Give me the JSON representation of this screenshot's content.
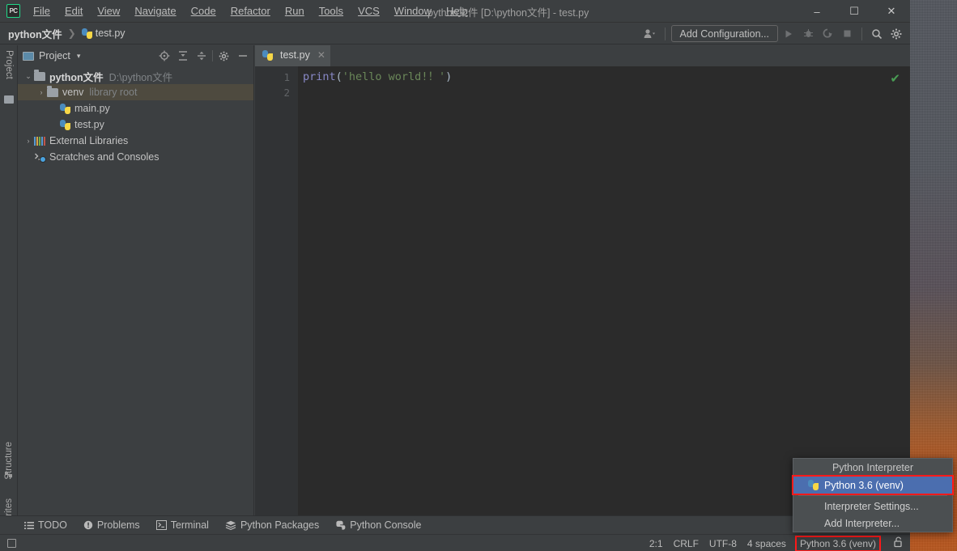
{
  "window": {
    "title": "python文件 [D:\\python文件] - test.py",
    "logo_label": "PC",
    "minimize": "–",
    "maximize": "☐",
    "close": "✕"
  },
  "menubar": {
    "items": [
      {
        "label": "File",
        "mnemonic": "F"
      },
      {
        "label": "Edit",
        "mnemonic": "E"
      },
      {
        "label": "View",
        "mnemonic": "V"
      },
      {
        "label": "Navigate",
        "mnemonic": "N"
      },
      {
        "label": "Code",
        "mnemonic": "C"
      },
      {
        "label": "Refactor",
        "mnemonic": "R"
      },
      {
        "label": "Run",
        "mnemonic": "u"
      },
      {
        "label": "Tools",
        "mnemonic": "T"
      },
      {
        "label": "VCS",
        "mnemonic": "S"
      },
      {
        "label": "Window",
        "mnemonic": "W"
      },
      {
        "label": "Help",
        "mnemonic": "H"
      }
    ]
  },
  "navbar": {
    "breadcrumbs": [
      {
        "label": "python文件"
      },
      {
        "label": "test.py"
      }
    ],
    "separator": "❯",
    "add_configuration": "Add Configuration...",
    "icons": {
      "user": "user-icon",
      "run": "▶",
      "debug": "debug-icon",
      "coverage": "coverage-icon",
      "stop": "■",
      "search": "search-icon",
      "settings": "gear-icon"
    }
  },
  "left_strip": {
    "project_label": "Project",
    "structure_label": "Structure",
    "favorites_label": "Favorites"
  },
  "project_panel": {
    "title": "Project",
    "dropdown": "▾",
    "actions": [
      "locate-icon",
      "expand-all-icon",
      "collapse-all-icon",
      "gear-icon",
      "hide-icon"
    ],
    "tree": [
      {
        "label": "python文件",
        "secondary": "D:\\python文件",
        "depth": 0,
        "arrow": "⌄",
        "icon": "folder-icon",
        "bold": true,
        "selected": false
      },
      {
        "label": "venv",
        "secondary": "library root",
        "depth": 1,
        "arrow": "›",
        "icon": "folder-icon",
        "bold": false,
        "selected": true
      },
      {
        "label": "main.py",
        "secondary": "",
        "depth": 2,
        "arrow": "",
        "icon": "python-file-icon",
        "bold": false,
        "selected": false
      },
      {
        "label": "test.py",
        "secondary": "",
        "depth": 2,
        "arrow": "",
        "icon": "python-file-icon",
        "bold": false,
        "selected": false
      },
      {
        "label": "External Libraries",
        "secondary": "",
        "depth": 0,
        "arrow": "›",
        "icon": "library-icon",
        "bold": false,
        "selected": false
      },
      {
        "label": "Scratches and Consoles",
        "secondary": "",
        "depth": 0,
        "arrow": "",
        "icon": "scratches-icon",
        "bold": false,
        "selected": false
      }
    ]
  },
  "editor": {
    "tabs": [
      {
        "label": "test.py",
        "icon": "python-file-icon",
        "close": "✕",
        "active": true
      }
    ],
    "line_numbers": [
      "1",
      "2"
    ],
    "code_line_1": {
      "fn": "print",
      "open_paren": "(",
      "string": "'hello world!！'",
      "close_paren": ")"
    },
    "inspection_status": "✔"
  },
  "bottom_bar": {
    "items": [
      {
        "label": "TODO",
        "icon": "todo-icon"
      },
      {
        "label": "Problems",
        "icon": "problems-icon"
      },
      {
        "label": "Terminal",
        "icon": "terminal-icon"
      },
      {
        "label": "Python Packages",
        "icon": "packages-icon"
      },
      {
        "label": "Python Console",
        "icon": "python-console-icon"
      }
    ]
  },
  "status_bar": {
    "widget_icon": "tool-window-icon",
    "caret_position": "2:1",
    "line_separator": "CRLF",
    "encoding": "UTF-8",
    "indent": "4 spaces",
    "interpreter": "Python 3.6 (venv)",
    "lock_icon": "🔓"
  },
  "interpreter_popup": {
    "title": "Python Interpreter",
    "items": [
      {
        "label": "Python 3.6 (venv)",
        "icon": "python-interpreter-icon",
        "selected": true,
        "highlighted": true
      },
      {
        "label": "Interpreter Settings...",
        "icon": "",
        "selected": false,
        "highlighted": false
      },
      {
        "label": "Add Interpreter...",
        "icon": "",
        "selected": false,
        "highlighted": false
      }
    ]
  },
  "colors": {
    "panel_bg": "#3c3f41",
    "editor_bg": "#2b2b2b",
    "gutter_bg": "#313335",
    "selection_blue": "#4b6eaf",
    "tree_selection": "#4e4a3f",
    "highlight_red": "#ff1a1a",
    "string_green": "#6a8759",
    "keyword_purple": "#8888c6",
    "check_green": "#499c54"
  }
}
